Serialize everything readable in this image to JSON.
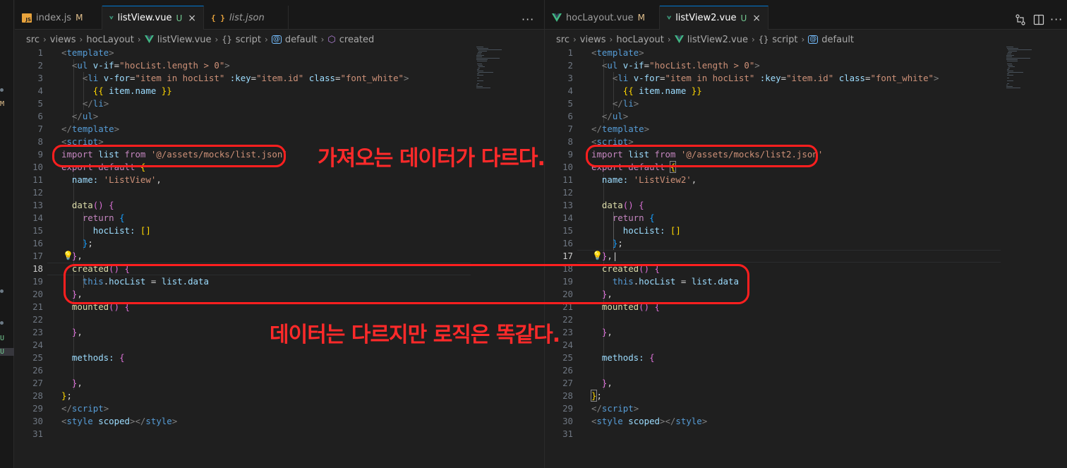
{
  "activity_bar": {
    "marks": [
      {
        "text": "M",
        "color": "#e2c08d"
      },
      {
        "text": "U",
        "color": "#73c991"
      },
      {
        "text": "U",
        "color": "#73c991"
      }
    ]
  },
  "left": {
    "tabs": [
      {
        "label": "index.js",
        "badge": "M",
        "icon": "js-file-icon"
      },
      {
        "label": "listView.vue",
        "badge": "U",
        "icon": "vue-file-icon",
        "close": "×"
      },
      {
        "label": "list.json",
        "icon": "json-file-icon"
      }
    ],
    "more_label": "···",
    "breadcrumb": {
      "src": "src",
      "views": "views",
      "folder": "hocLayout",
      "file": "listView.vue",
      "script": "script",
      "default": "default",
      "created": "created"
    },
    "import_path": "'@/assets/mocks/list.json'",
    "name_value": "'ListView'",
    "current_line": "18"
  },
  "right": {
    "tabs": [
      {
        "label": "hocLayout.vue",
        "badge": "M",
        "icon": "vue-file-icon"
      },
      {
        "label": "listView2.vue",
        "badge": "U",
        "icon": "vue-file-icon",
        "close": "×"
      }
    ],
    "breadcrumb": {
      "src": "src",
      "views": "views",
      "folder": "hocLayout",
      "file": "listView2.vue",
      "script": "script",
      "default": "default"
    },
    "import_path": "'@/assets/mocks/list2.json'",
    "name_value": "'ListView2'",
    "current_line": "17"
  },
  "code": {
    "line_numbers": [
      "1",
      "2",
      "3",
      "4",
      "5",
      "6",
      "7",
      "8",
      "9",
      "10",
      "11",
      "12",
      "13",
      "14",
      "15",
      "16",
      "17",
      "18",
      "19",
      "20",
      "21",
      "22",
      "23",
      "24",
      "25",
      "26",
      "27",
      "28",
      "29",
      "30",
      "31"
    ],
    "template_open": "template",
    "ul_tag": "ul",
    "vif_attr": "v-if",
    "vif_value": "\"hocList.length > 0\"",
    "li_tag": "li",
    "vfor_attr": "v-for",
    "vfor_value": "\"item in hocList\"",
    "key_attr": ":key",
    "key_value": "\"item.id\"",
    "class_attr": "class",
    "class_value": "\"font_white\"",
    "mustache_expr": "item.name",
    "script_tag": "script",
    "import_kw": "import",
    "from_kw": "from",
    "list_var": "list",
    "export_kw": "export",
    "default_kw": "default",
    "name_key": "name:",
    "data_fn": "data",
    "return_kw": "return",
    "hoclist_key": "hocList:",
    "created_fn": "created",
    "this_kw": "this",
    "hoclist_prop": "hocList",
    "list_data": "list.data",
    "mounted_fn": "mounted",
    "methods_key": "methods:",
    "style_tag": "style",
    "scoped_attr": "scoped"
  },
  "annotations": {
    "note_import": "가져오는 데이터가 다르다.",
    "note_logic": "데이터는 다르지만 로직은 똑같다.",
    "color": "#ff1f1f"
  }
}
